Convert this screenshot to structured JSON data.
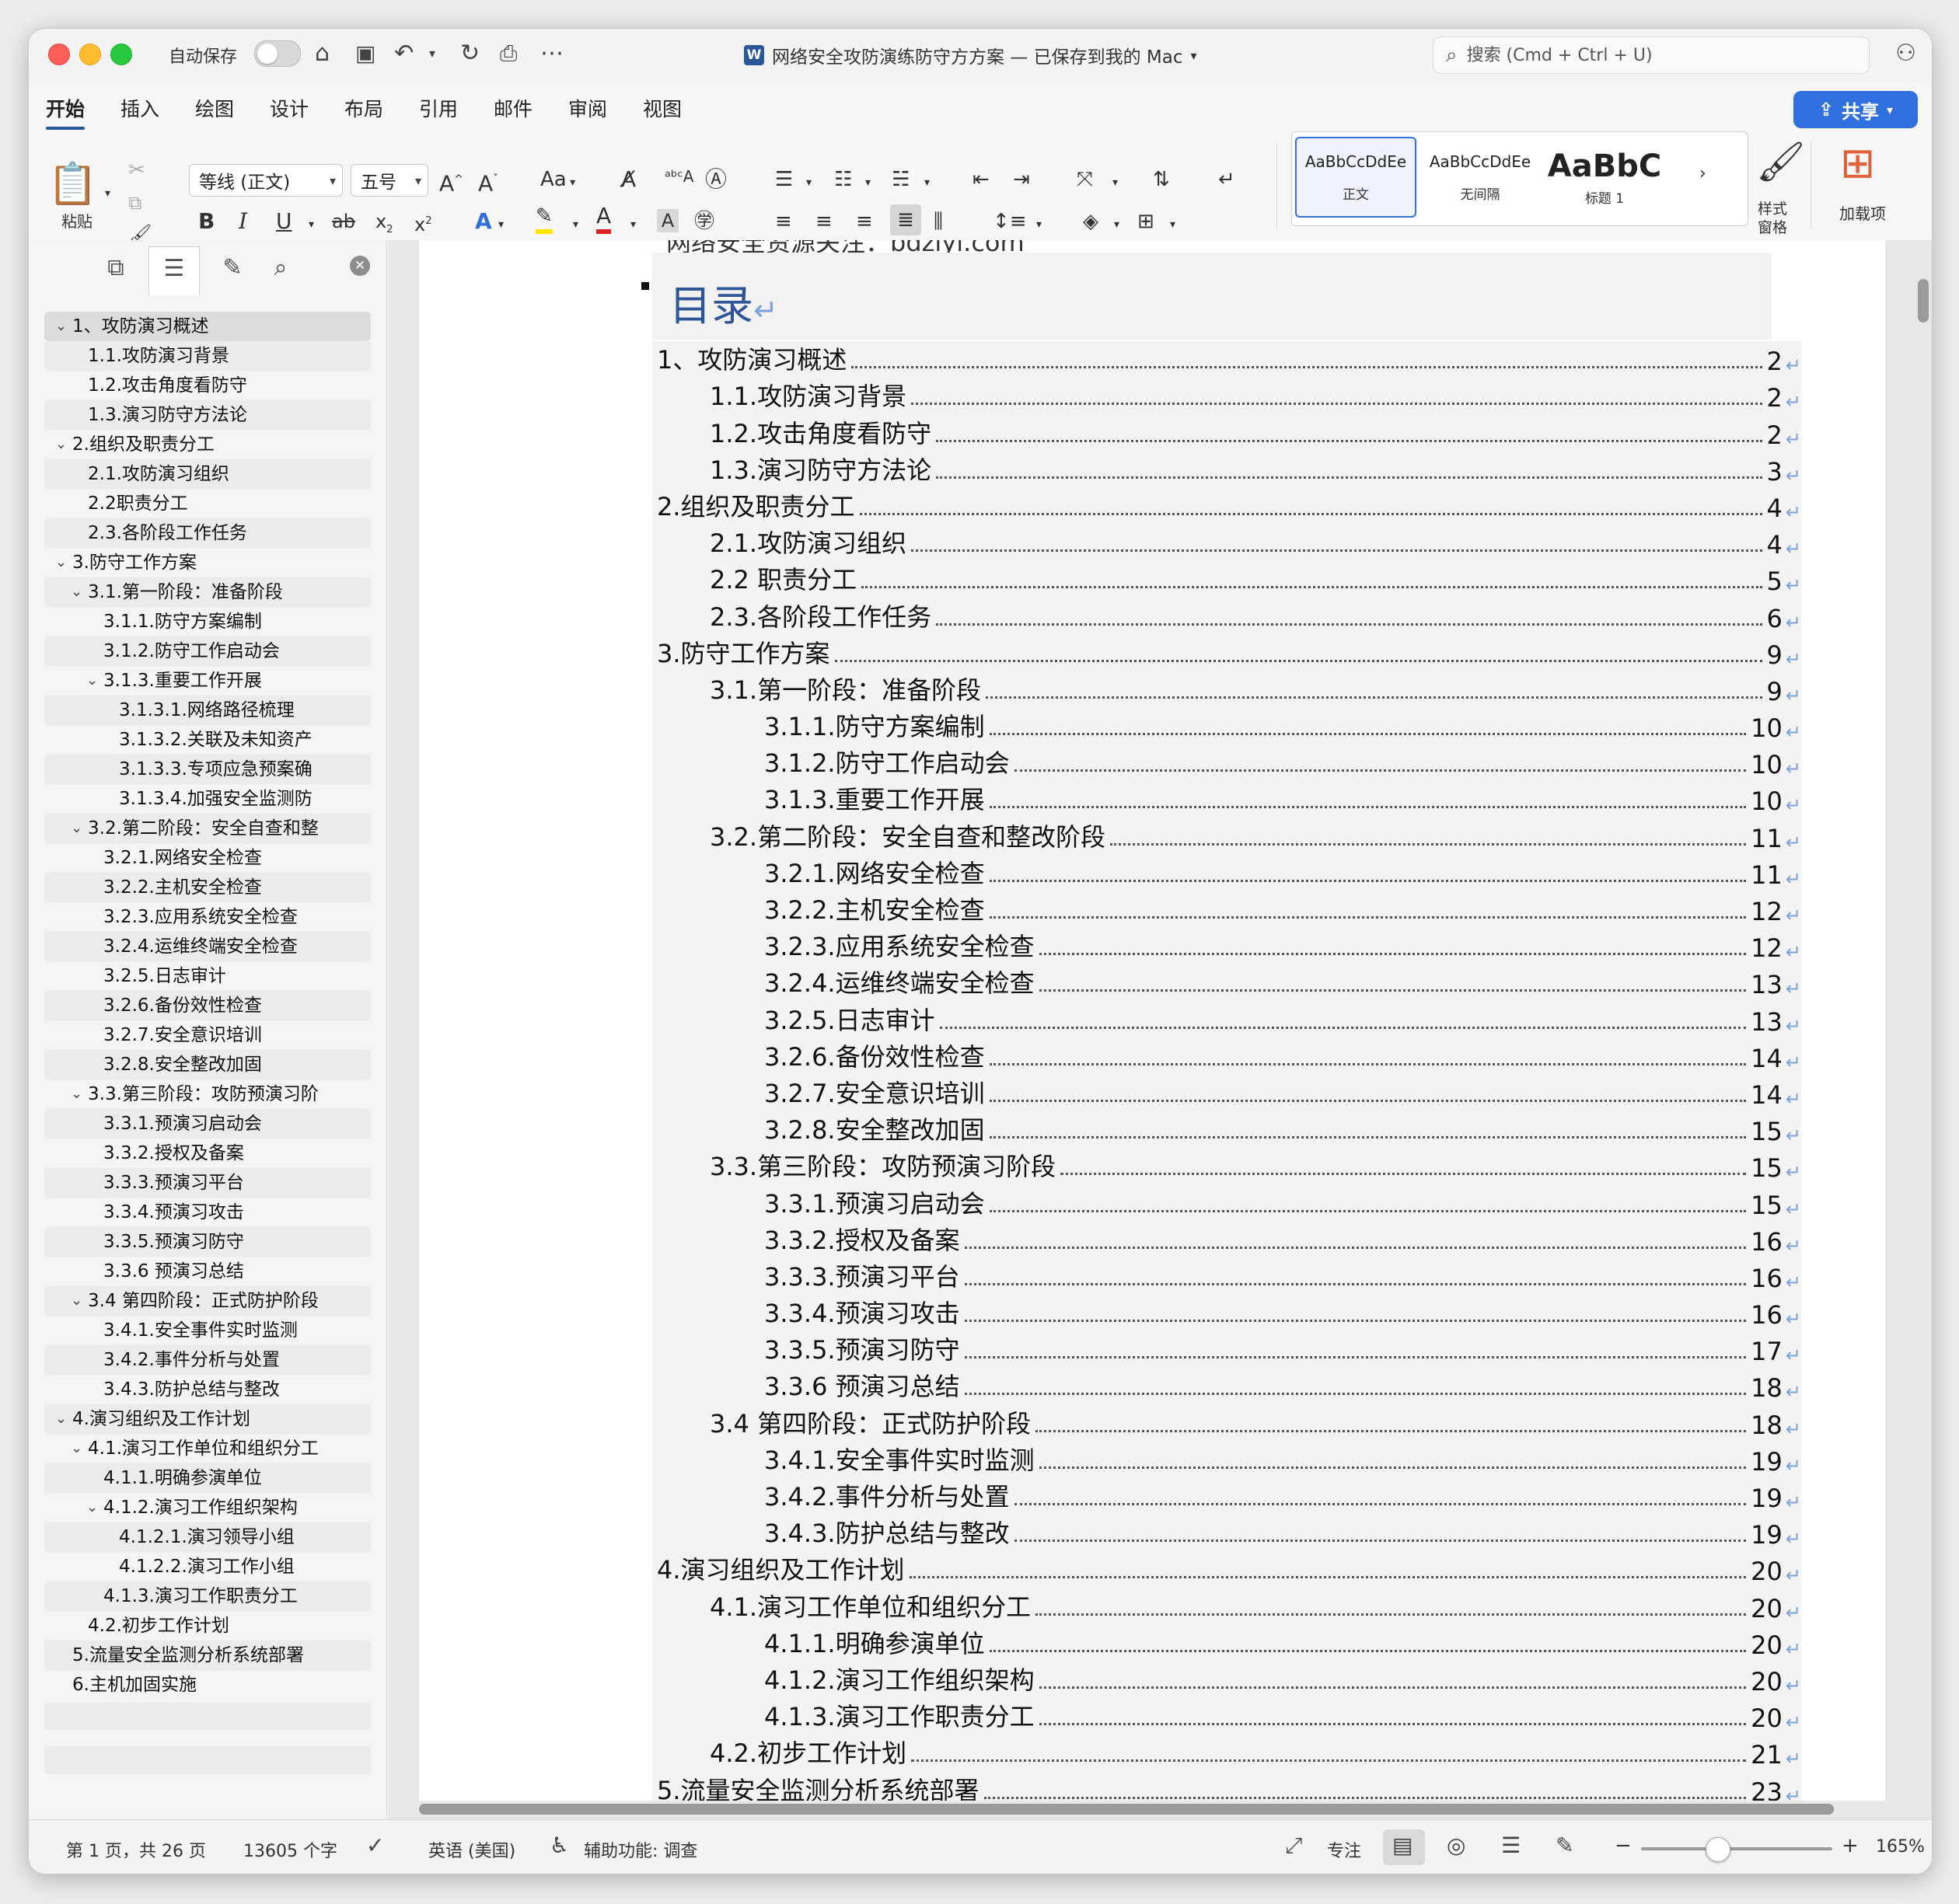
{
  "titlebar": {
    "autosave_label": "自动保存",
    "doc_title": "网络安全攻防演练防守方方案 — 已保存到我的 Mac",
    "word_badge": "W",
    "search_placeholder": "搜索 (Cmd + Ctrl + U)"
  },
  "tabs": [
    "开始",
    "插入",
    "绘图",
    "设计",
    "布局",
    "引用",
    "邮件",
    "审阅",
    "视图"
  ],
  "share_label": "共享",
  "ribbon": {
    "paste_label": "粘贴",
    "font_name": "等线 (正文)",
    "font_size": "五号",
    "styles": [
      {
        "sample": "AaBbCcDdEe",
        "name": "正文"
      },
      {
        "sample": "AaBbCcDdEe",
        "name": "无间隔"
      },
      {
        "sample": "AaBbC",
        "name": "标题 1"
      }
    ],
    "styles_pane_label": "样式\n窗格",
    "addins_label": "加载项"
  },
  "nav": {
    "items": [
      {
        "label": "1、攻防演习概述",
        "level": 0,
        "expanded": true,
        "selected": true
      },
      {
        "label": "1.1.攻防演习背景",
        "level": 1
      },
      {
        "label": "1.2.攻击角度看防守",
        "level": 1
      },
      {
        "label": "1.3.演习防守方法论",
        "level": 1
      },
      {
        "label": "2.组织及职责分工",
        "level": 0,
        "expanded": true
      },
      {
        "label": "2.1.攻防演习组织",
        "level": 1
      },
      {
        "label": "2.2职责分工",
        "level": 1
      },
      {
        "label": "2.3.各阶段工作任务",
        "level": 1
      },
      {
        "label": "3.防守工作方案",
        "level": 0,
        "expanded": true
      },
      {
        "label": "3.1.第一阶段：准备阶段",
        "level": 1,
        "expanded": true
      },
      {
        "label": "3.1.1.防守方案编制",
        "level": 2
      },
      {
        "label": "3.1.2.防守工作启动会",
        "level": 2
      },
      {
        "label": "3.1.3.重要工作开展",
        "level": 2,
        "expanded": true
      },
      {
        "label": "3.1.3.1.网络路径梳理",
        "level": 3
      },
      {
        "label": "3.1.3.2.关联及未知资产",
        "level": 3
      },
      {
        "label": "3.1.3.3.专项应急预案确",
        "level": 3
      },
      {
        "label": "3.1.3.4.加强安全监测防",
        "level": 3
      },
      {
        "label": "3.2.第二阶段：安全自查和整",
        "level": 1,
        "expanded": true
      },
      {
        "label": "3.2.1.网络安全检查",
        "level": 2
      },
      {
        "label": "3.2.2.主机安全检查",
        "level": 2
      },
      {
        "label": "3.2.3.应用系统安全检查",
        "level": 2
      },
      {
        "label": "3.2.4.运维终端安全检查",
        "level": 2
      },
      {
        "label": "3.2.5.日志审计",
        "level": 2
      },
      {
        "label": "3.2.6.备份效性检查",
        "level": 2
      },
      {
        "label": "3.2.7.安全意识培训",
        "level": 2
      },
      {
        "label": "3.2.8.安全整改加固",
        "level": 2
      },
      {
        "label": "3.3.第三阶段：攻防预演习阶",
        "level": 1,
        "expanded": true
      },
      {
        "label": "3.3.1.预演习启动会",
        "level": 2
      },
      {
        "label": "3.3.2.授权及备案",
        "level": 2
      },
      {
        "label": "3.3.3.预演习平台",
        "level": 2
      },
      {
        "label": "3.3.4.预演习攻击",
        "level": 2
      },
      {
        "label": "3.3.5.预演习防守",
        "level": 2
      },
      {
        "label": "3.3.6 预演习总结",
        "level": 2
      },
      {
        "label": "3.4 第四阶段：正式防护阶段",
        "level": 1,
        "expanded": true
      },
      {
        "label": "3.4.1.安全事件实时监测",
        "level": 2
      },
      {
        "label": "3.4.2.事件分析与处置",
        "level": 2
      },
      {
        "label": "3.4.3.防护总结与整改",
        "level": 2
      },
      {
        "label": "4.演习组织及工作计划",
        "level": 0,
        "expanded": true
      },
      {
        "label": "4.1.演习工作单位和组织分工",
        "level": 1,
        "expanded": true
      },
      {
        "label": "4.1.1.明确参演单位",
        "level": 2
      },
      {
        "label": "4.1.2.演习工作组织架构",
        "level": 2,
        "expanded": true
      },
      {
        "label": "4.1.2.1.演习领导小组",
        "level": 3
      },
      {
        "label": "4.1.2.2.演习工作小组",
        "level": 3
      },
      {
        "label": "4.1.3.演习工作职责分工",
        "level": 2
      },
      {
        "label": "4.2.初步工作计划",
        "level": 1
      },
      {
        "label": "5.流量安全监测分析系统部署",
        "level": 0
      },
      {
        "label": "6.主机加固实施",
        "level": 0
      }
    ]
  },
  "document": {
    "cut_line": "网络安全资源关注：bdziyi.com",
    "toc_title": "目录",
    "toc": [
      {
        "label": "1、攻防演习概述",
        "page": "2",
        "level": 1
      },
      {
        "label": "1.1.攻防演习背景",
        "page": "2",
        "level": 2
      },
      {
        "label": "1.2.攻击角度看防守",
        "page": "2",
        "level": 2
      },
      {
        "label": "1.3.演习防守方法论",
        "page": "3",
        "level": 2
      },
      {
        "label": "2.组织及职责分工",
        "page": "4",
        "level": 1
      },
      {
        "label": "2.1.攻防演习组织",
        "page": "4",
        "level": 2
      },
      {
        "label": "2.2 职责分工",
        "page": "5",
        "level": 2
      },
      {
        "label": "2.3.各阶段工作任务",
        "page": "6",
        "level": 2
      },
      {
        "label": "3.防守工作方案",
        "page": "9",
        "level": 1
      },
      {
        "label": "3.1.第一阶段：准备阶段",
        "page": "9",
        "level": 2
      },
      {
        "label": "3.1.1.防守方案编制",
        "page": "10",
        "level": 3
      },
      {
        "label": "3.1.2.防守工作启动会",
        "page": "10",
        "level": 3
      },
      {
        "label": "3.1.3.重要工作开展",
        "page": "10",
        "level": 3
      },
      {
        "label": "3.2.第二阶段：安全自查和整改阶段",
        "page": "11",
        "level": 2
      },
      {
        "label": "3.2.1.网络安全检查",
        "page": "11",
        "level": 3
      },
      {
        "label": "3.2.2.主机安全检查",
        "page": "12",
        "level": 3
      },
      {
        "label": "3.2.3.应用系统安全检查",
        "page": "12",
        "level": 3
      },
      {
        "label": "3.2.4.运维终端安全检查",
        "page": "13",
        "level": 3
      },
      {
        "label": "3.2.5.日志审计",
        "page": "13",
        "level": 3
      },
      {
        "label": "3.2.6.备份效性检查",
        "page": "14",
        "level": 3
      },
      {
        "label": "3.2.7.安全意识培训",
        "page": "14",
        "level": 3
      },
      {
        "label": "3.2.8.安全整改加固",
        "page": "15",
        "level": 3
      },
      {
        "label": "3.3.第三阶段：攻防预演习阶段",
        "page": "15",
        "level": 2
      },
      {
        "label": "3.3.1.预演习启动会",
        "page": "15",
        "level": 3
      },
      {
        "label": "3.3.2.授权及备案",
        "page": "16",
        "level": 3
      },
      {
        "label": "3.3.3.预演习平台",
        "page": "16",
        "level": 3
      },
      {
        "label": "3.3.4.预演习攻击",
        "page": "16",
        "level": 3
      },
      {
        "label": "3.3.5.预演习防守",
        "page": "17",
        "level": 3
      },
      {
        "label": "3.3.6  预演习总结",
        "page": "18",
        "level": 3
      },
      {
        "label": "3.4  第四阶段：正式防护阶段",
        "page": "18",
        "level": 2
      },
      {
        "label": "3.4.1.安全事件实时监测",
        "page": "19",
        "level": 3
      },
      {
        "label": "3.4.2.事件分析与处置",
        "page": "19",
        "level": 3
      },
      {
        "label": "3.4.3.防护总结与整改",
        "page": "19",
        "level": 3
      },
      {
        "label": "4.演习组织及工作计划",
        "page": "20",
        "level": 1
      },
      {
        "label": "4.1.演习工作单位和组织分工",
        "page": "20",
        "level": 2
      },
      {
        "label": "4.1.1.明确参演单位",
        "page": "20",
        "level": 3
      },
      {
        "label": "4.1.2.演习工作组织架构",
        "page": "20",
        "level": 3
      },
      {
        "label": "4.1.3.演习工作职责分工",
        "page": "20",
        "level": 3
      },
      {
        "label": "4.2.初步工作计划",
        "page": "21",
        "level": 2
      },
      {
        "label": "5.流量安全监测分析系统部署",
        "page": "23",
        "level": 1
      }
    ]
  },
  "statusbar": {
    "page_info": "第 1 页，共 26 页",
    "word_count": "13605 个字",
    "language": "英语 (美国)",
    "accessibility": "辅助功能: 调查",
    "focus_label": "专注",
    "zoom_minus": "−",
    "zoom_plus": "+",
    "zoom": "165%",
    "zoom_fraction": 0.4
  },
  "colors": {
    "accent": "#2f6fde",
    "toc_title": "#2f5597",
    "pilcrow": "#7da1d8",
    "word_blue": "#2b579a"
  }
}
